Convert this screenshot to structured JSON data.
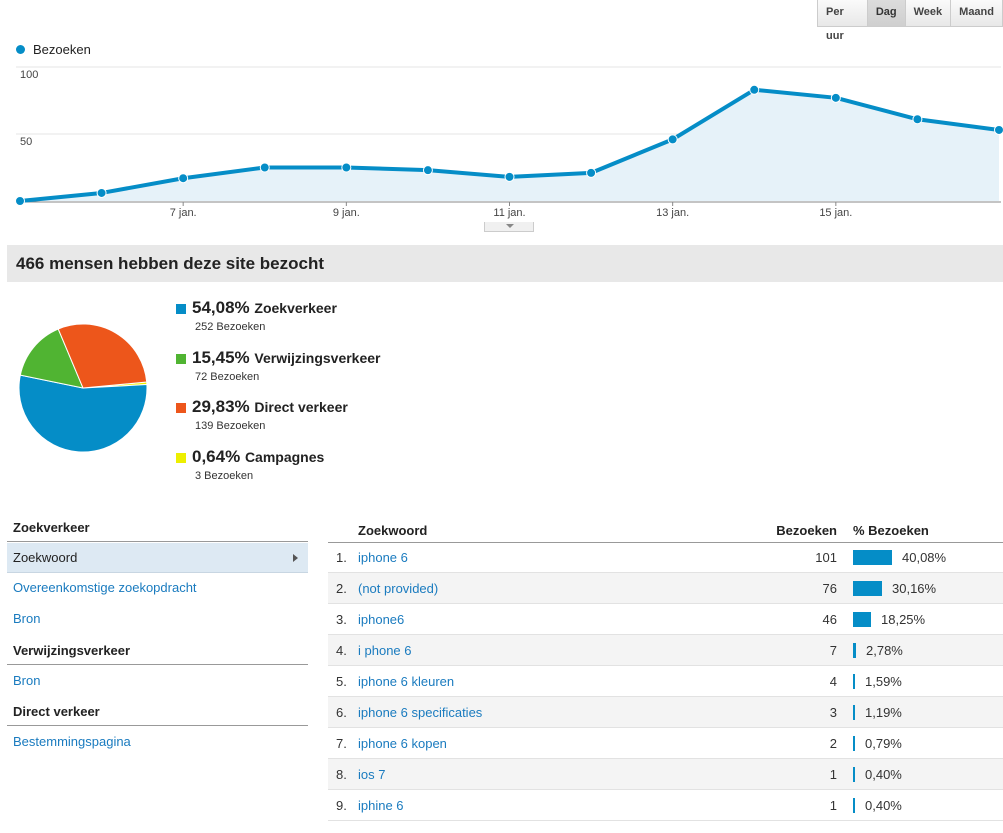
{
  "granularity": {
    "options": [
      "Per uur",
      "Dag",
      "Week",
      "Maand"
    ],
    "selected": "Dag"
  },
  "chart_data": {
    "type": "area",
    "series": [
      {
        "name": "Bezoeken",
        "color": "#058dc7",
        "values": [
          0,
          6,
          17,
          25,
          25,
          23,
          18,
          21,
          46,
          83,
          77,
          61,
          53
        ]
      }
    ],
    "x": [
      "5 jan.",
      "6 jan.",
      "7 jan.",
      "8 jan.",
      "9 jan.",
      "10 jan.",
      "11 jan.",
      "12 jan.",
      "13 jan.",
      "14 jan.",
      "15 jan.",
      "16 jan.",
      "17 jan."
    ],
    "x_tick_labels": [
      "7 jan.",
      "9 jan.",
      "11 jan.",
      "13 jan.",
      "15 jan."
    ],
    "y_ticks": [
      50,
      100
    ],
    "ylim": [
      0,
      100
    ],
    "grid": true,
    "legend": "top-left"
  },
  "summary": {
    "title": "466 mensen hebben deze site bezocht"
  },
  "traffic_sources": [
    {
      "pct": "54,08%",
      "name": "Zoekverkeer",
      "sub": "252 Bezoeken",
      "value": 252,
      "color": "#058dc7"
    },
    {
      "pct": "15,45%",
      "name": "Verwijzingsverkeer",
      "sub": "72 Bezoeken",
      "value": 72,
      "color": "#50b432"
    },
    {
      "pct": "29,83%",
      "name": "Direct verkeer",
      "sub": "139 Bezoeken",
      "value": 139,
      "color": "#ed561b"
    },
    {
      "pct": "0,64%",
      "name": "Campagnes",
      "sub": "3 Bezoeken",
      "value": 3,
      "color": "#edef00"
    }
  ],
  "leftnav": {
    "search_head": "Zoekverkeer",
    "search_links": [
      "Zoekwoord",
      "Overeenkomstige zoekopdracht",
      "Bron"
    ],
    "referral_head": "Verwijzingsverkeer",
    "referral_links": [
      "Bron"
    ],
    "direct_head": "Direct verkeer",
    "direct_links": [
      "Bestemmingspagina"
    ]
  },
  "table": {
    "headers": {
      "keyword": "Zoekwoord",
      "visits": "Bezoeken",
      "pct": "% Bezoeken"
    },
    "rows": [
      {
        "idx": "1.",
        "keyword": "iphone 6",
        "visits": "101",
        "pct": "40,08%",
        "fraction": 0.4008
      },
      {
        "idx": "2.",
        "keyword": "(not provided)",
        "visits": "76",
        "pct": "30,16%",
        "fraction": 0.3016
      },
      {
        "idx": "3.",
        "keyword": "iphone6",
        "visits": "46",
        "pct": "18,25%",
        "fraction": 0.1825
      },
      {
        "idx": "4.",
        "keyword": "i phone 6",
        "visits": "7",
        "pct": "2,78%",
        "fraction": 0.0278
      },
      {
        "idx": "5.",
        "keyword": "iphone 6 kleuren",
        "visits": "4",
        "pct": "1,59%",
        "fraction": 0.0159
      },
      {
        "idx": "6.",
        "keyword": "iphone 6 specificaties",
        "visits": "3",
        "pct": "1,19%",
        "fraction": 0.0119
      },
      {
        "idx": "7.",
        "keyword": "iphone 6 kopen",
        "visits": "2",
        "pct": "0,79%",
        "fraction": 0.0079
      },
      {
        "idx": "8.",
        "keyword": "ios 7",
        "visits": "1",
        "pct": "0,40%",
        "fraction": 0.004
      },
      {
        "idx": "9.",
        "keyword": "iphine 6",
        "visits": "1",
        "pct": "0,40%",
        "fraction": 0.004
      }
    ]
  }
}
